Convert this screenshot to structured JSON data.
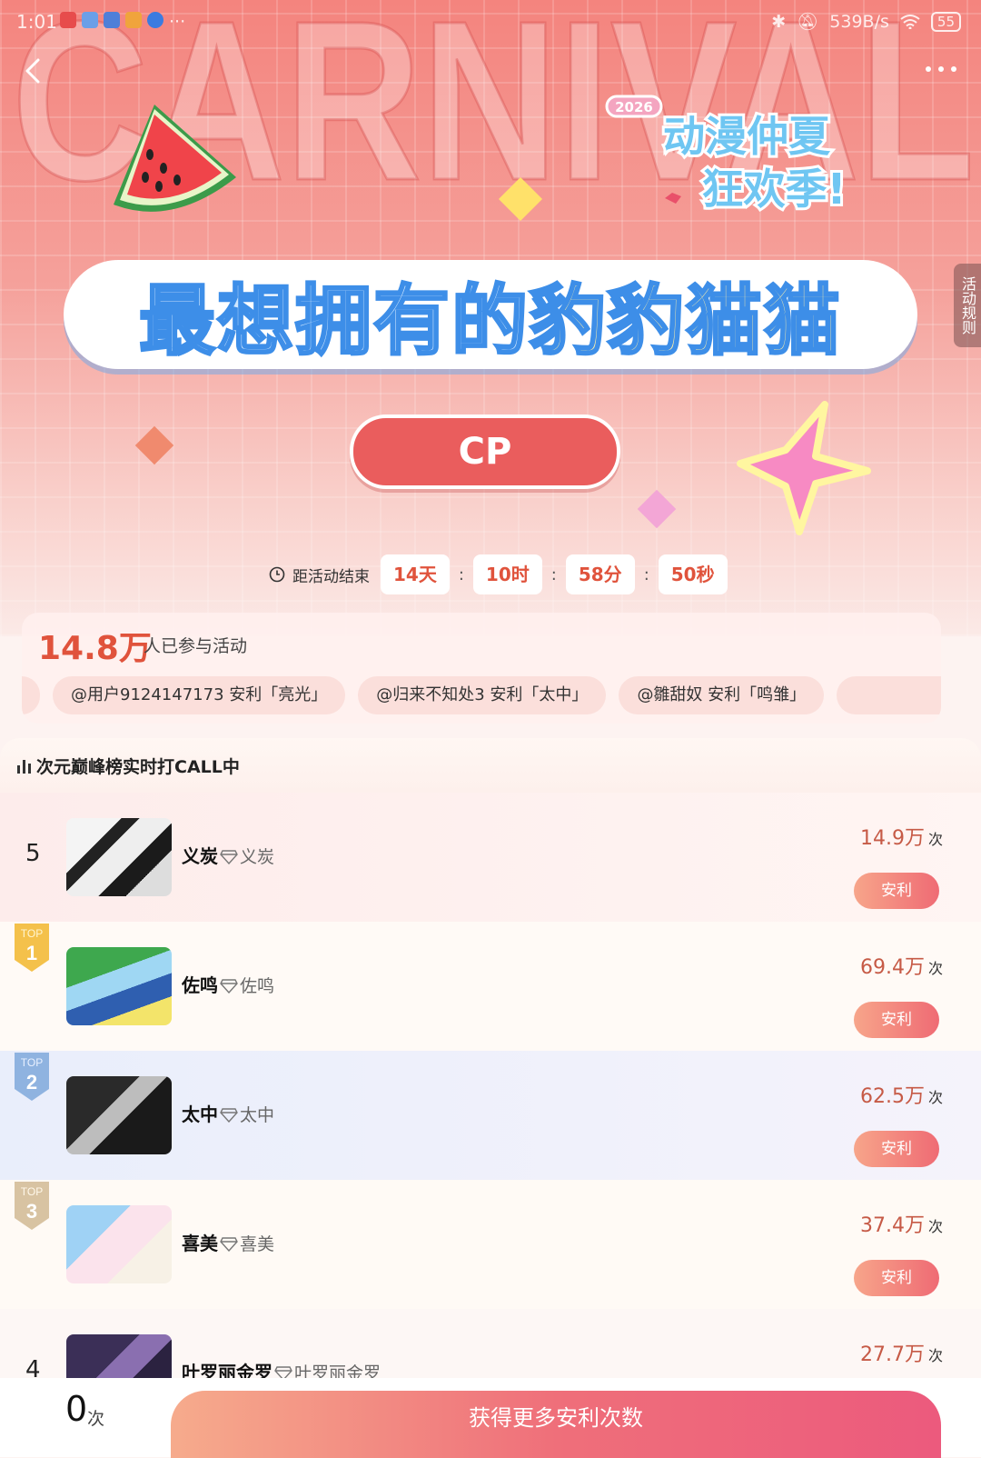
{
  "status_bar": {
    "time": "1:01",
    "network_speed": "539B/s",
    "battery": "55"
  },
  "hero": {
    "background_word": "CARNIVAL",
    "festival_year": "2026",
    "festival_line1": "动漫仲夏",
    "festival_line2": "狂欢季!",
    "title_part1": "最想拥有的",
    "title_part2": "豹豹猫猫",
    "category_button": "CP",
    "rules_tab": "活动规则"
  },
  "countdown": {
    "label": "距活动结束",
    "days": "14天",
    "hours": "10时",
    "minutes": "58分",
    "seconds": "50秒",
    "separator": ":"
  },
  "participants": {
    "count": "14.8万",
    "label": "人已参与活动",
    "ticker": [
      "@用户9124147173 安利「亮光」",
      "@归来不知处3 安利「太中」",
      "@雛甜奴 安利「鸣雏」"
    ]
  },
  "ranking": {
    "title": "次元巅峰榜实时打CALL中",
    "vote_button_label": "安利",
    "times_unit": "次",
    "badge_label": "TOP",
    "rows": [
      {
        "rank": "5",
        "name": "义炭",
        "sub": "义炭",
        "votes": "14.9万"
      },
      {
        "rank": "1",
        "name": "佐鸣",
        "sub": "佐鸣",
        "votes": "69.4万"
      },
      {
        "rank": "2",
        "name": "太中",
        "sub": "太中",
        "votes": "62.5万"
      },
      {
        "rank": "3",
        "name": "喜美",
        "sub": "喜美",
        "votes": "37.4万"
      },
      {
        "rank": "4",
        "name": "叶罗丽金罗",
        "sub": "叶罗丽金罗",
        "votes": "27.7万"
      }
    ]
  },
  "bottom_bar": {
    "remaining": "0",
    "remaining_unit": "次",
    "get_more_button": "获得更多安利次数"
  },
  "colors": {
    "accent": "#e0533c",
    "title_stroke": "#3d8ee8",
    "button_gradient_start": "#f7a58a",
    "button_gradient_end": "#ef6b74",
    "top1_badge": "#f4c14b",
    "top2_badge": "#8fb3e0",
    "top3_badge": "#d8c3a2"
  },
  "icons": [
    "back-icon",
    "more-icon",
    "clock-icon",
    "bars-chart-icon",
    "gem-icon",
    "bluetooth-icon",
    "wifi-icon",
    "battery-icon"
  ]
}
